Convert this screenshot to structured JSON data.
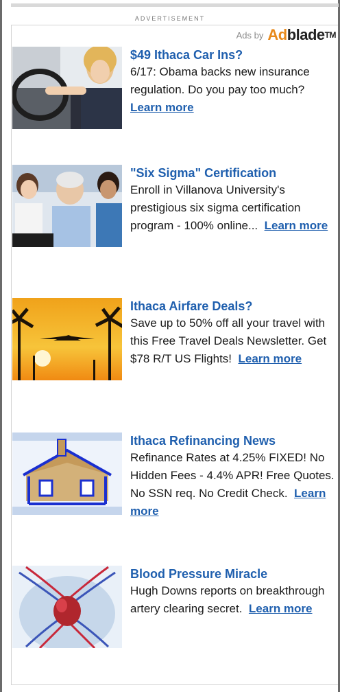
{
  "header": {
    "advertisement_label": "ADVERTISEMENT",
    "ads_by": "Ads by",
    "logo_part1": "Ad",
    "logo_part2": "blade",
    "logo_tm": "TM"
  },
  "ads": [
    {
      "title": "$49 Ithaca Car Ins?",
      "desc": "6/17: Obama backs new insurance regulation. Do you pay too much?",
      "cta": "Learn more",
      "thumb_icon": "woman-driving-car-image"
    },
    {
      "title": "\"Six Sigma\" Certification",
      "desc": "Enroll in Villanova University's prestigious six sigma certification program - 100% online...",
      "cta": "Learn more",
      "thumb_icon": "people-meeting-image"
    },
    {
      "title": "Ithaca Airfare Deals?",
      "desc": "Save up to 50% off all your travel with this Free Travel Deals Newsletter. Get $78 R/T US Flights!",
      "cta": "Learn more",
      "thumb_icon": "airplane-sunset-image"
    },
    {
      "title": "Ithaca Refinancing News",
      "desc": "Refinance Rates at 4.25% FIXED! No Hidden Fees - 4.4% APR! Free Quotes. No SSN req. No Credit Check.",
      "cta": "Learn more",
      "thumb_icon": "log-house-image"
    },
    {
      "title": "Blood Pressure Miracle",
      "desc": "Hugh Downs reports on breakthrough artery clearing secret.",
      "cta": "Learn more",
      "thumb_icon": "heart-arteries-image"
    }
  ],
  "colors": {
    "link": "#1f5fae",
    "logo_accent": "#e8891a"
  }
}
